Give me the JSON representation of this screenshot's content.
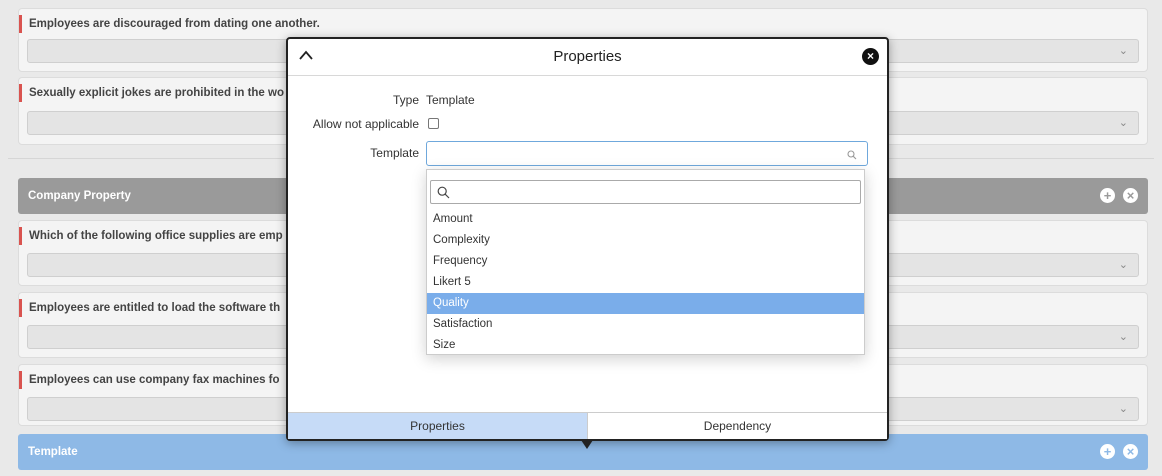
{
  "background": {
    "questions_top": [
      {
        "text": "Employees are discouraged from dating one another."
      },
      {
        "text": "Sexually explicit jokes are prohibited in the wo"
      }
    ],
    "section_company": {
      "title": "Company Property"
    },
    "questions_company": [
      {
        "text": "Which of the following office supplies are emp"
      },
      {
        "text": "Employees are entitled to load the software th"
      },
      {
        "text": "Employees can use company fax machines fo"
      }
    ],
    "section_template": {
      "title": "Template"
    },
    "add_icon_glyph": "+",
    "remove_icon_glyph": "×",
    "chevron_glyph": "⌄"
  },
  "modal": {
    "title": "Properties",
    "collapse_icon": "chevron-up-icon",
    "close_glyph": "×",
    "type_label": "Type",
    "type_value": "Template",
    "allow_na_label": "Allow not applicable",
    "allow_na_checked": false,
    "template_label": "Template",
    "template_value": "",
    "dropdown": {
      "search_value": "",
      "options": [
        "Amount",
        "Complexity",
        "Frequency",
        "Likert 5",
        "Quality",
        "Satisfaction",
        "Size"
      ],
      "selected": "Quality"
    },
    "tabs": [
      {
        "label": "Properties",
        "active": true
      },
      {
        "label": "Dependency",
        "active": false
      }
    ]
  },
  "colors": {
    "accent_blue": "#7aadea",
    "section_gray": "#9a9a9a",
    "section_blue": "#8eb9e6",
    "required_marker": "#d9534f"
  }
}
